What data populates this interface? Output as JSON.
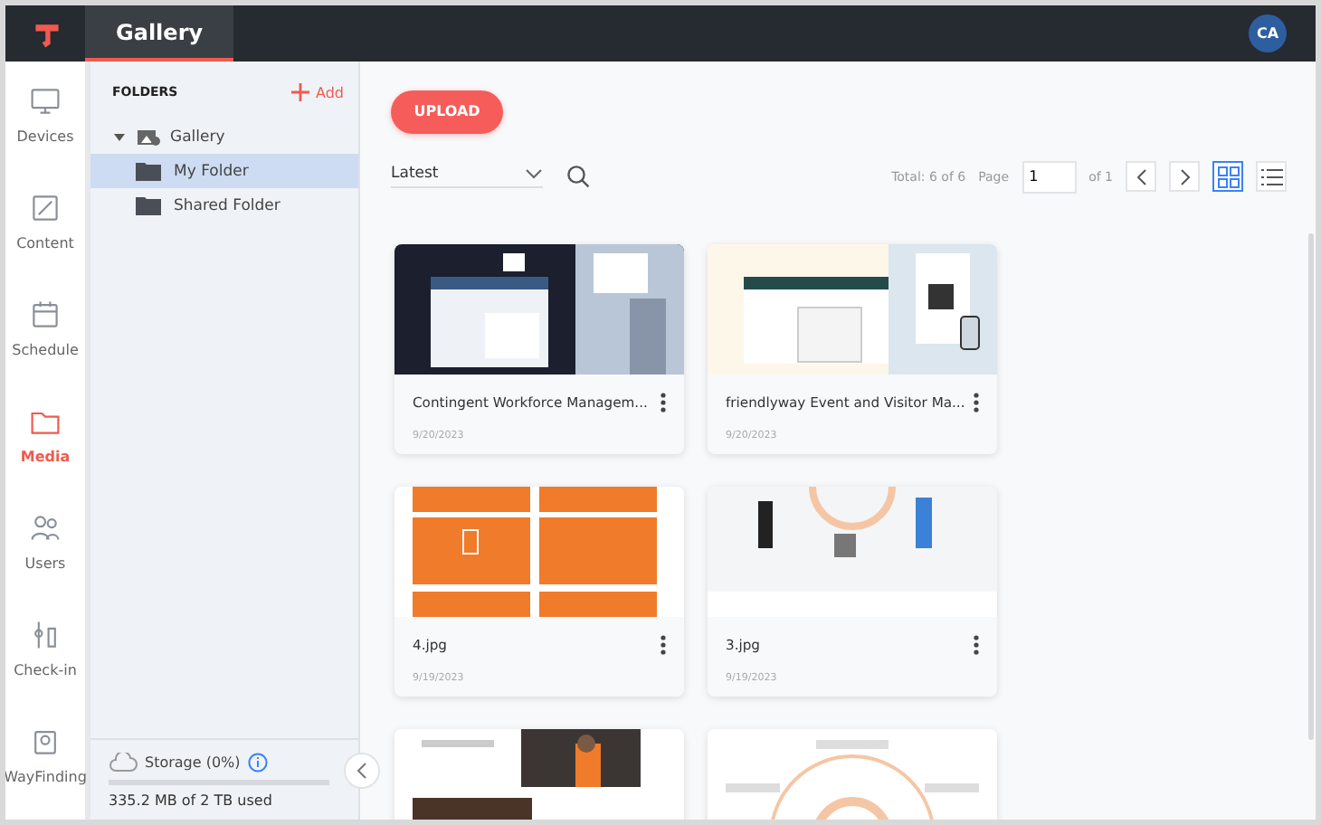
{
  "topbar": {
    "tabs": [
      {
        "label": "Gallery",
        "selected": true
      }
    ],
    "avatar": "CA"
  },
  "nav": [
    {
      "label": "Devices",
      "selected": false
    },
    {
      "label": "Content",
      "selected": false
    },
    {
      "label": "Schedule",
      "selected": false
    },
    {
      "label": "Media",
      "selected": true
    },
    {
      "label": "Users",
      "selected": false
    },
    {
      "label": "Check-in",
      "selected": false
    },
    {
      "label": "WayFinding",
      "selected": false
    }
  ],
  "folders": {
    "title": "FOLDERS",
    "add": "Add",
    "tree": [
      {
        "label": "Gallery",
        "expanded": true,
        "selected": false,
        "children": [
          {
            "label": "My Folder",
            "selected": true
          },
          {
            "label": "Shared Folder",
            "selected": false
          }
        ]
      }
    ]
  },
  "storage": {
    "label": "Storage (0%)",
    "used": "335.2 MB of 2 TB used"
  },
  "toolbar": {
    "upload": "UPLOAD",
    "sort": "Latest",
    "total": "Total: 6 of 6",
    "page_label": "Page",
    "page": "1",
    "of": "of 1",
    "views": [
      {
        "kind": "grid",
        "selected": true
      },
      {
        "kind": "list",
        "selected": false
      }
    ]
  },
  "cards": [
    {
      "kind": "file",
      "name": "Contingent Workforce Managem...",
      "date": "9/20/2023"
    },
    {
      "kind": "file",
      "name": "friendlyway Event and Visitor Ma...",
      "date": "9/20/2023"
    },
    {
      "kind": "file",
      "name": "4.jpg",
      "date": "9/19/2023"
    },
    {
      "kind": "file",
      "name": "3.jpg",
      "date": "9/19/2023"
    },
    {
      "kind": "picture"
    },
    {
      "kind": "picture"
    }
  ]
}
